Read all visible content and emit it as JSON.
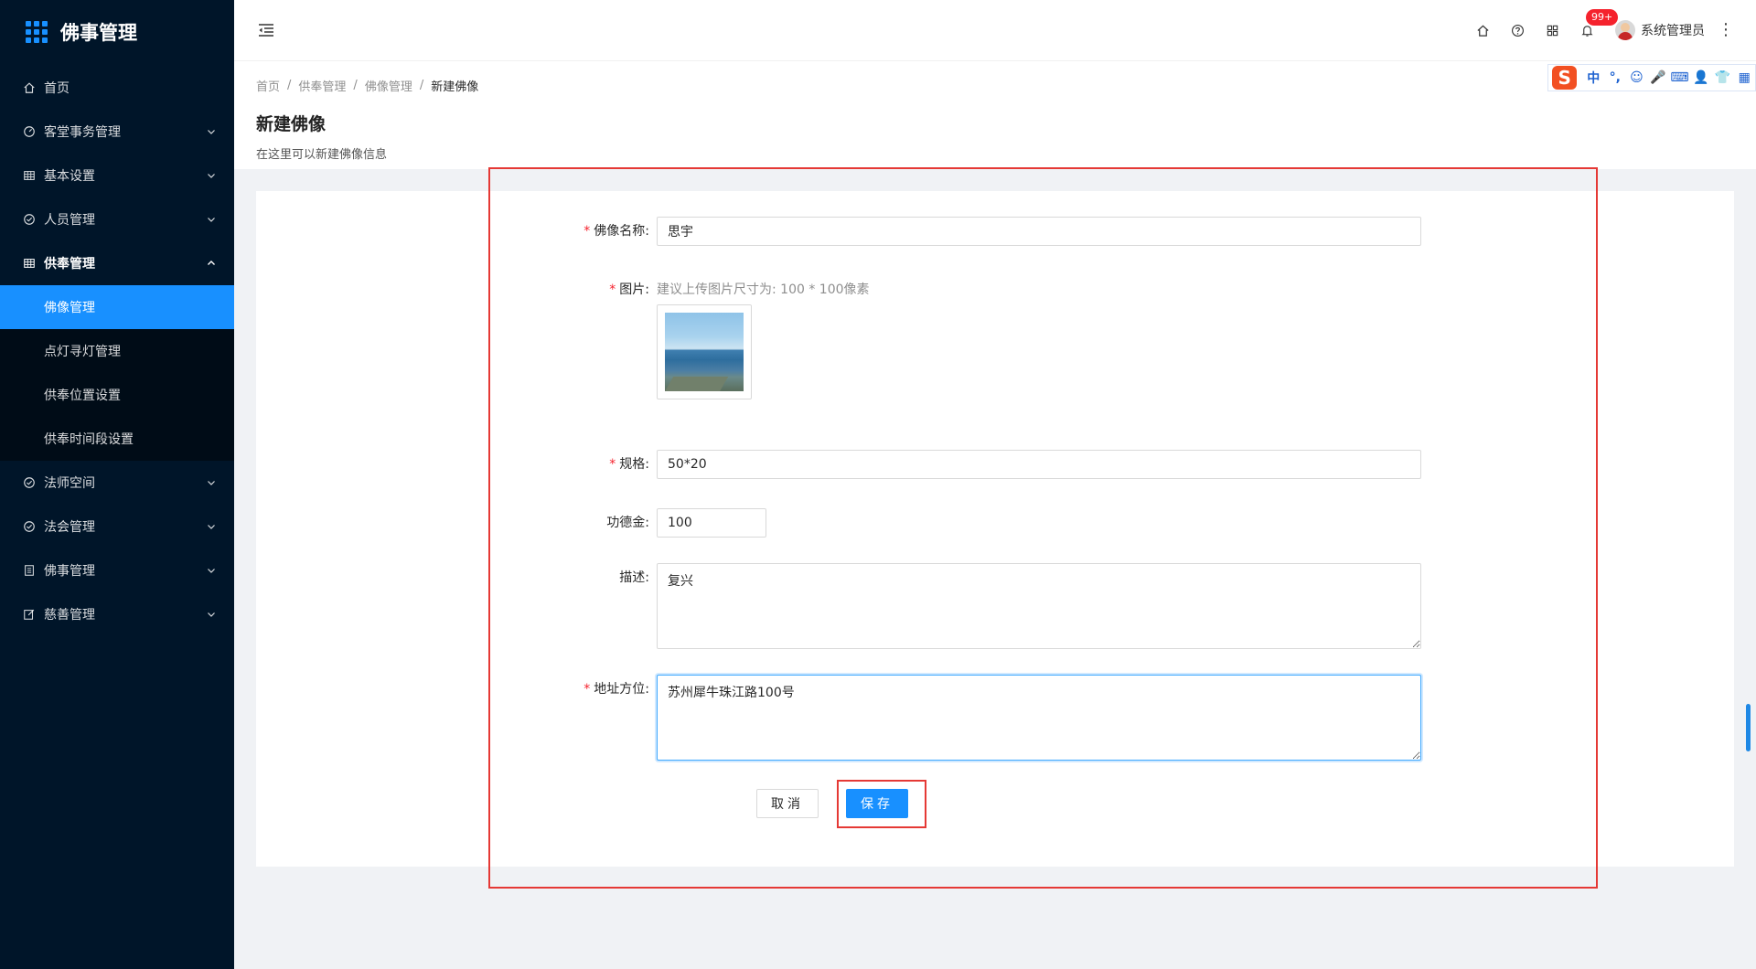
{
  "app": {
    "title": "佛事管理"
  },
  "sidebar": {
    "items": [
      {
        "label": "首页",
        "icon": "home-icon"
      },
      {
        "label": "客堂事务管理",
        "icon": "dashboard-icon"
      },
      {
        "label": "基本设置",
        "icon": "table-icon"
      },
      {
        "label": "人员管理",
        "icon": "check-circle-icon"
      },
      {
        "label": "供奉管理",
        "icon": "table-icon"
      },
      {
        "label": "法师空间",
        "icon": "check-circle-icon"
      },
      {
        "label": "法会管理",
        "icon": "check-circle-icon"
      },
      {
        "label": "佛事管理",
        "icon": "document-icon"
      },
      {
        "label": "慈善管理",
        "icon": "edit-icon"
      }
    ],
    "submenu": [
      {
        "label": "佛像管理"
      },
      {
        "label": "点灯寻灯管理"
      },
      {
        "label": "供奉位置设置"
      },
      {
        "label": "供奉时间段设置"
      }
    ]
  },
  "header": {
    "notification_badge": "99+",
    "username": "系统管理员"
  },
  "breadcrumb": [
    "首页",
    "供奉管理",
    "佛像管理",
    "新建佛像"
  ],
  "page": {
    "title": "新建佛像",
    "description": "在这里可以新建佛像信息"
  },
  "ime": {
    "logo": "S",
    "items": [
      "中",
      "°,",
      "☺",
      "🎤",
      "⌨",
      "👤",
      "👕",
      "▦"
    ]
  },
  "form": {
    "name": {
      "label": "佛像名称:",
      "value": "思宇"
    },
    "image": {
      "label": "图片:",
      "hint": "建议上传图片尺寸为: 100 * 100像素"
    },
    "spec": {
      "label": "规格:",
      "value": "50*20"
    },
    "merit": {
      "label": "功德金:",
      "value": "100"
    },
    "description": {
      "label": "描述:",
      "value": "复兴"
    },
    "address": {
      "label": "地址方位:",
      "value": "苏州犀牛珠江路100号"
    },
    "cancel_label": "取消",
    "save_label": "保存"
  },
  "colors": {
    "sidebar_bg": "#001529",
    "primary": "#1890ff",
    "required": "#f5222d",
    "annotation": "#e53935"
  }
}
